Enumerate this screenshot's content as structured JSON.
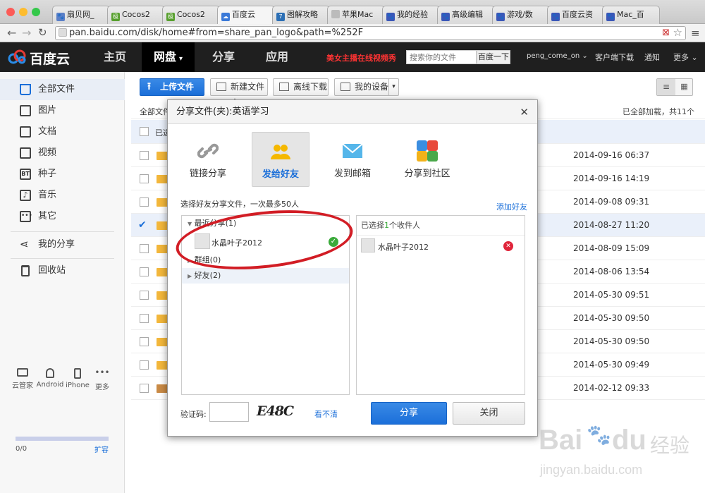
{
  "browser": {
    "tabs": [
      {
        "label": "扇贝网_"
      },
      {
        "label": "Cocos2"
      },
      {
        "label": "Cocos2"
      },
      {
        "label": "百度云"
      },
      {
        "label": "图解攻略"
      },
      {
        "label": "苹果Mac"
      },
      {
        "label": "我的经验"
      },
      {
        "label": "高级编辑"
      },
      {
        "label": "游戏/数"
      },
      {
        "label": "百度云资"
      },
      {
        "label": "Mac_百"
      }
    ],
    "url": "pan.baidu.com/disk/home#from=share_pan_logo&path=%252F"
  },
  "header": {
    "logo": "百度云",
    "nav": [
      "主页",
      "网盘",
      "分享",
      "应用"
    ],
    "promo": "美女主播在线视频秀",
    "search_placeholder": "搜索你的文件",
    "search_button": "百度一下",
    "user": "peng_come_on",
    "client_download": "客户端下载",
    "notice": "通知",
    "more": "更多"
  },
  "sidebar": {
    "items": [
      {
        "label": "全部文件"
      },
      {
        "label": "图片"
      },
      {
        "label": "文档"
      },
      {
        "label": "视频"
      },
      {
        "label": "种子"
      },
      {
        "label": "音乐"
      },
      {
        "label": "其它"
      },
      {
        "label": "我的分享"
      },
      {
        "label": "回收站"
      }
    ],
    "devices": [
      "云管家",
      "Android",
      "iPhone",
      "更多"
    ],
    "quota": "0/0",
    "expand": "扩容"
  },
  "toolbar": {
    "upload": "上传文件",
    "new_folder": "新建文件夹",
    "offline": "离线下载",
    "devices": "我的设备"
  },
  "filelist": {
    "breadcrumb": "全部文件",
    "status": "已全部加载，共11个",
    "header_label": "已选",
    "rows": [
      {
        "date": "2014-09-16 06:37"
      },
      {
        "date": "2014-09-16 14:19"
      },
      {
        "date": "2014-09-08 09:31"
      },
      {
        "date": "2014-08-27 11:20"
      },
      {
        "date": "2014-08-09 15:09"
      },
      {
        "date": "2014-08-06 13:54"
      },
      {
        "date": "2014-05-30 09:51"
      },
      {
        "date": "2014-05-30 09:50"
      },
      {
        "date": "2014-05-30 09:50"
      },
      {
        "date": "2014-05-30 09:49"
      },
      {
        "date": "2014-02-12 09:33"
      }
    ]
  },
  "dialog": {
    "title": "分享文件(夹):英语学习",
    "tabs": [
      "链接分享",
      "发给好友",
      "发到邮箱",
      "分享到社区"
    ],
    "hint": "选择好友分享文件，一次最多50人",
    "add_friend": "添加好友",
    "recent": "最近分享(1)",
    "recent_friend": "水晶叶子2012",
    "groups": "群组(0)",
    "friends": "好友(2)",
    "selected_prefix": "已选择",
    "selected_count": "1",
    "selected_suffix": "个收件人",
    "selected_friend": "水晶叶子2012",
    "captcha_label": "验证码:",
    "captcha_text": "E48C",
    "captcha_refresh": "看不清",
    "share_button": "分享",
    "close_button": "关闭"
  },
  "watermark": {
    "brand": "Bai",
    "brand2": "du",
    "jingyan": "经验",
    "url": "jingyan.baidu.com"
  }
}
